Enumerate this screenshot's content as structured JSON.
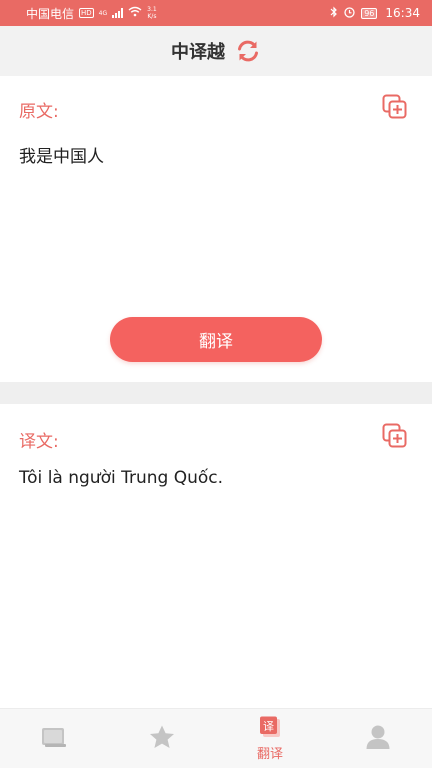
{
  "status_bar": {
    "carrier": "中国电信",
    "hd": "HD",
    "network": "4G",
    "speed_value": "3.1",
    "speed_unit": "K/s",
    "battery": "96",
    "time": "16:34"
  },
  "header": {
    "title": "中译越"
  },
  "source": {
    "label": "原文:",
    "text": "我是中国人"
  },
  "translate_button": {
    "label": "翻译"
  },
  "target": {
    "label": "译文:",
    "text": "Tôi là người Trung Quốc."
  },
  "bottom_nav": {
    "items": [
      {
        "icon": "book-icon",
        "label": ""
      },
      {
        "icon": "star-icon",
        "label": ""
      },
      {
        "icon": "translate-icon",
        "label": "翻译",
        "icon_text": "译",
        "active": true
      },
      {
        "icon": "user-icon",
        "label": ""
      }
    ]
  },
  "colors": {
    "accent": "#e96a64",
    "button": "#f4625f",
    "inactive_icon": "#c4c4c4"
  }
}
